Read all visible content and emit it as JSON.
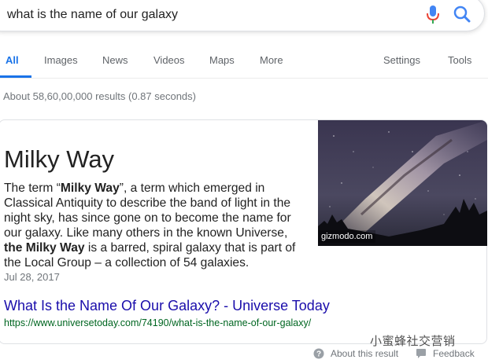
{
  "search": {
    "query": "what is the name of our galaxy"
  },
  "tabs": [
    {
      "label": "All"
    },
    {
      "label": "Images"
    },
    {
      "label": "News"
    },
    {
      "label": "Videos"
    },
    {
      "label": "Maps"
    },
    {
      "label": "More"
    },
    {
      "label": "Settings"
    },
    {
      "label": "Tools"
    }
  ],
  "results_stats": "About 58,60,00,000 results (0.87 seconds)",
  "featured": {
    "title": "Milky Way",
    "snippet_parts": [
      "The term “",
      "Milky Way",
      "”, a term which emerged in Classical Antiquity to describe the band of light in the night sky, has since gone on to become the name for our galaxy. Like many others in the known Universe, ",
      "the Milky Way",
      " is a barred, spiral galaxy that is part of the Local Group – a collection of 54 galaxies."
    ],
    "date": "Jul 28, 2017",
    "image_credit": "gizmodo.com",
    "link_title": "What Is the Name Of Our Galaxy? - Universe Today",
    "link_url": "https://www.universetoday.com/74190/what-is-the-name-of-our-galaxy/"
  },
  "footer": {
    "about": "About this result",
    "feedback": "Feedback"
  },
  "watermark": "小蜜蜂社交营销",
  "colors": {
    "accent": "#1a73e8",
    "link": "#1a0dab",
    "url": "#006621",
    "muted": "#70757a"
  }
}
